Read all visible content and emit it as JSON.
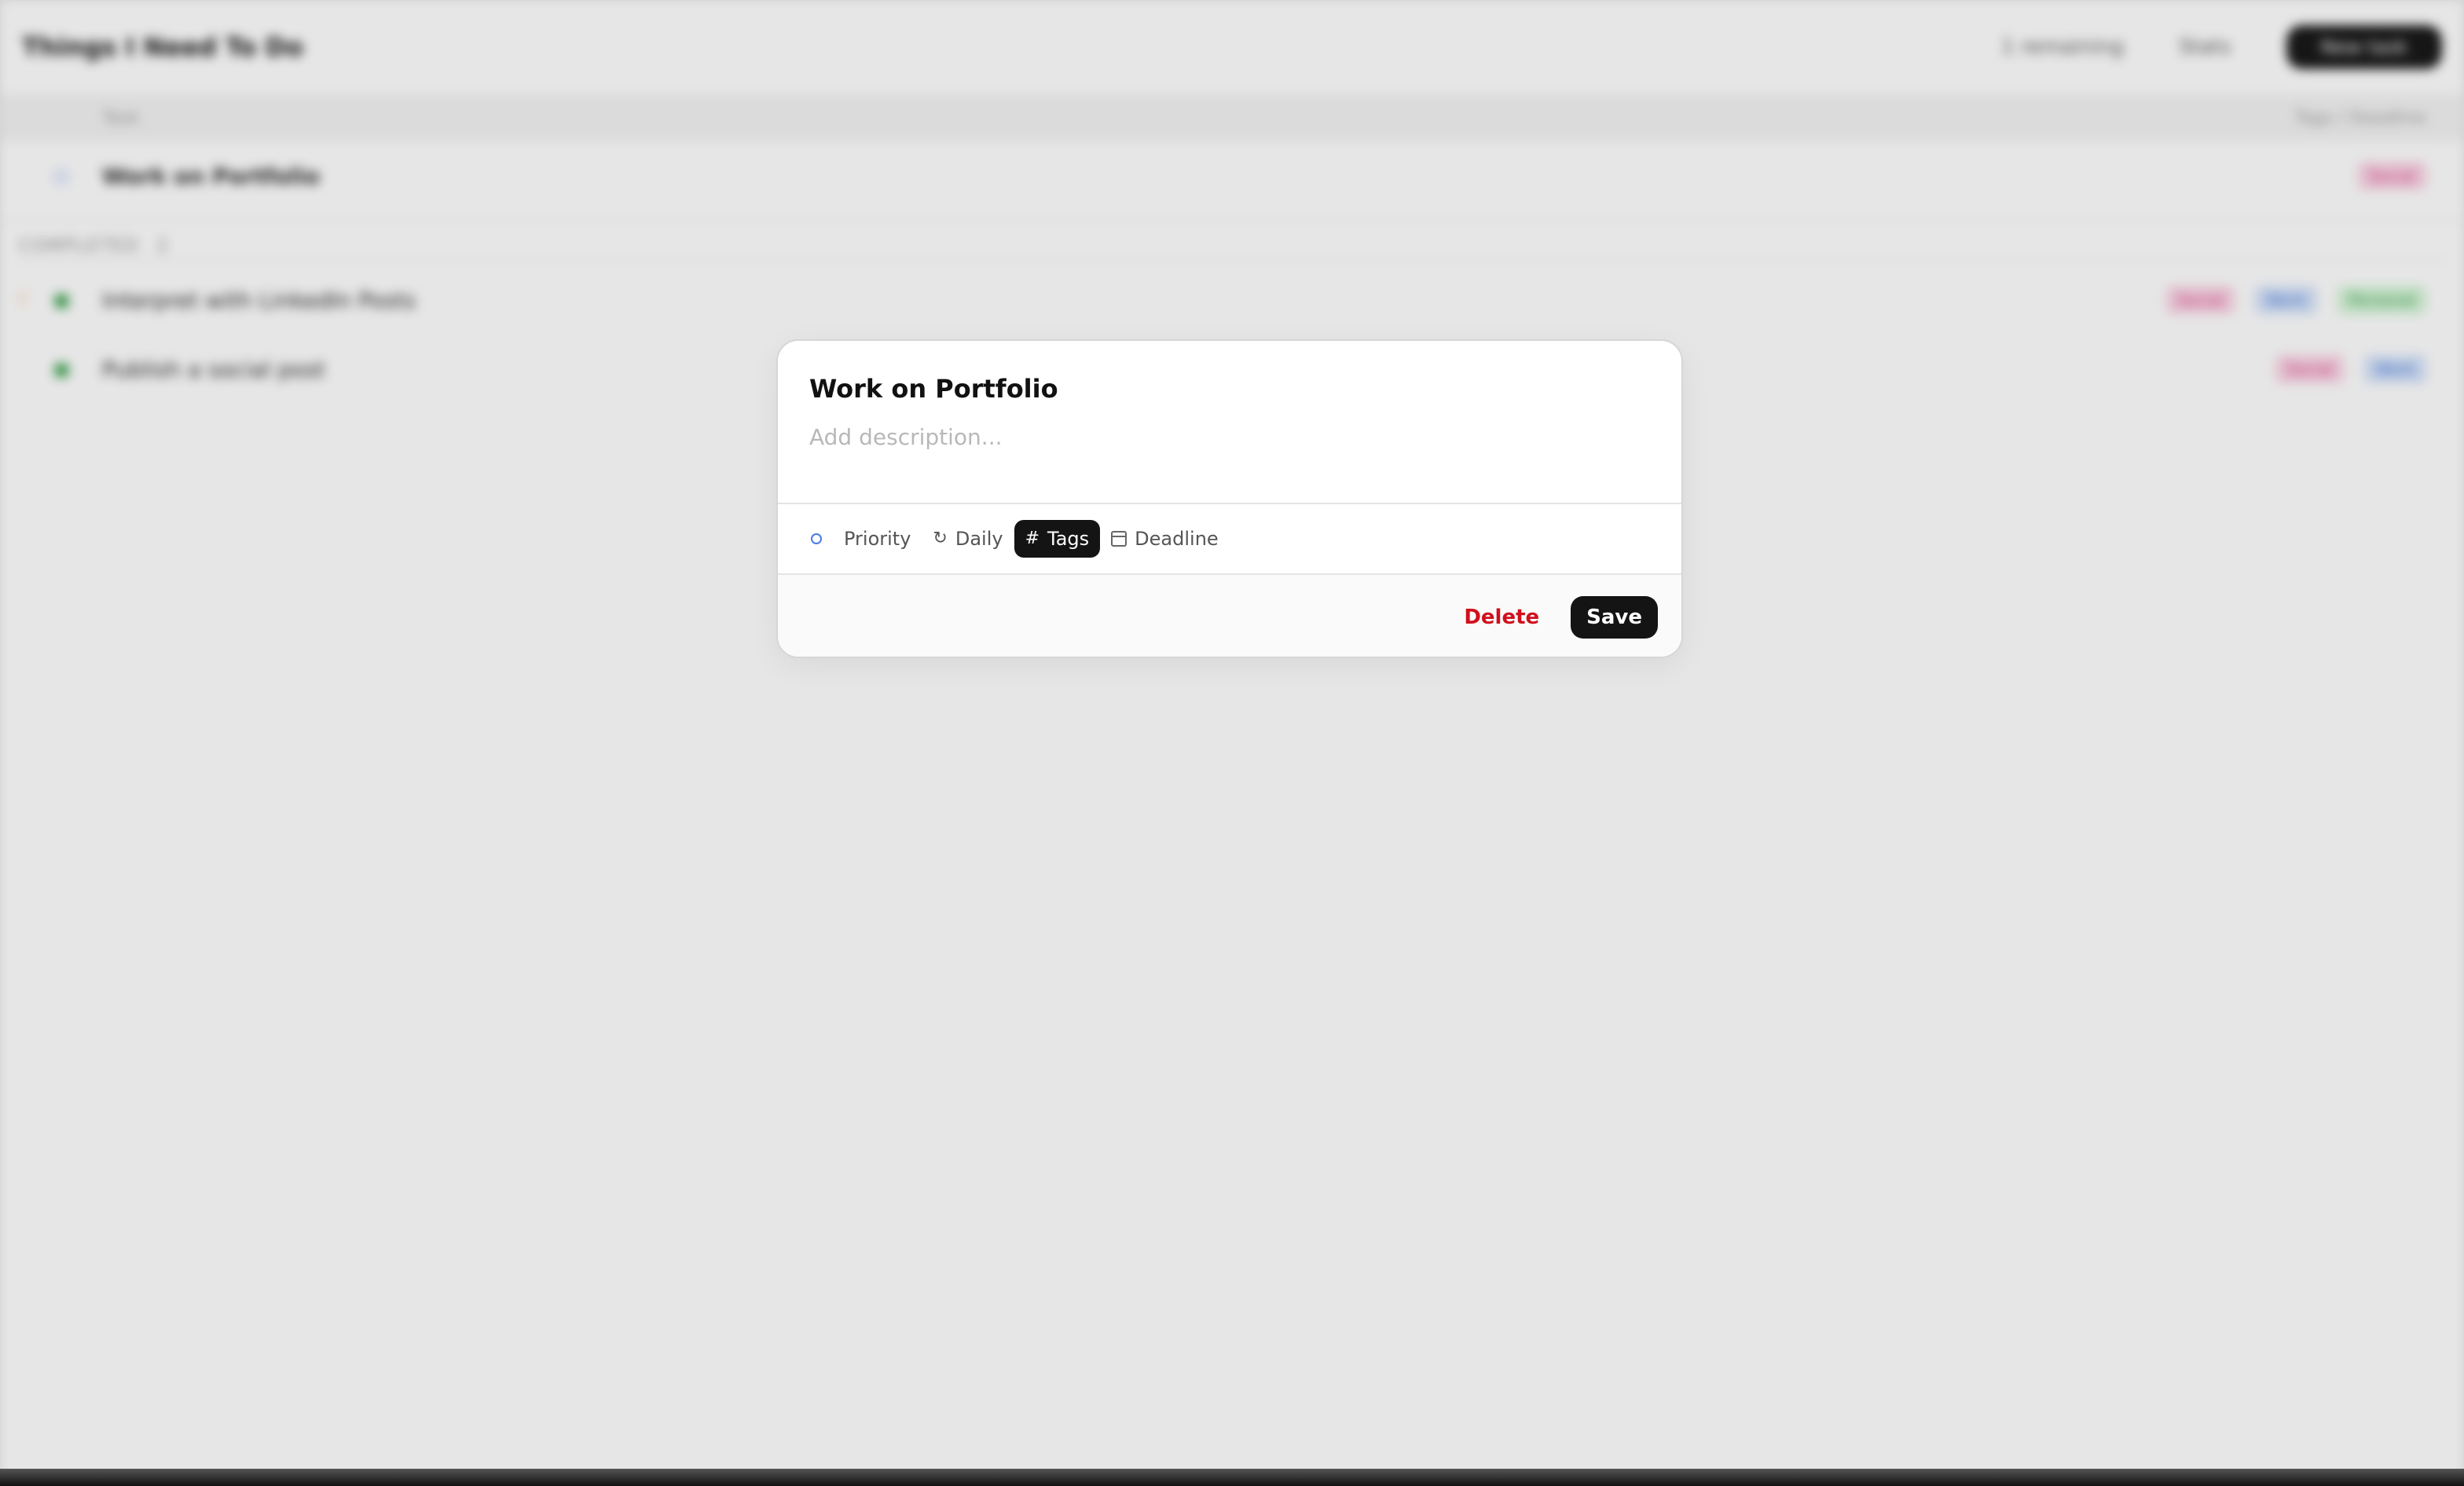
{
  "background": {
    "app_title": "Things I Need To Do",
    "header_links": [
      "1 remaining",
      "Stats"
    ],
    "new_button": "New task",
    "columns": {
      "task": "Task",
      "tags_deadline": "Tags / Deadline"
    },
    "active_tasks": [
      {
        "title": "Work on Portfolio",
        "tags": [
          {
            "label": "Social",
            "color": "pink"
          }
        ]
      }
    ],
    "completed_section": {
      "label": "COMPLETED",
      "count": "2"
    },
    "completed_tasks": [
      {
        "title": "Interpret with LinkedIn Posts",
        "priority": "!",
        "tags": [
          {
            "label": "Social",
            "color": "pink"
          },
          {
            "label": "Work",
            "color": "blue"
          },
          {
            "label": "Personal",
            "color": "green"
          }
        ]
      },
      {
        "title": "Publish a social post",
        "priority": "",
        "tags": [
          {
            "label": "Social",
            "color": "pink"
          },
          {
            "label": "Work",
            "color": "blue"
          }
        ]
      }
    ]
  },
  "modal": {
    "title": "Work on Portfolio",
    "description_placeholder": "Add description...",
    "toolbar": {
      "priority_label": "Priority",
      "repeat_label": "Daily",
      "tags_label": "Tags",
      "deadline_label": "Deadline"
    },
    "delete_label": "Delete",
    "save_label": "Save"
  },
  "colors": {
    "delete": "#d0101c",
    "dark_button": "#141414",
    "status_circle": "#4a7be6"
  }
}
